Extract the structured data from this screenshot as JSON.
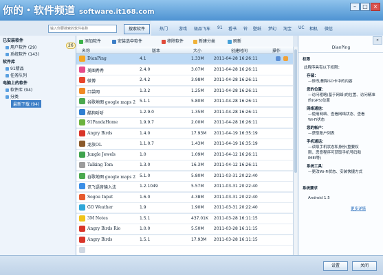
{
  "watermark": {
    "cn": "你的・软件频道",
    "url": "software.it168.com"
  },
  "search": {
    "placeholder": "输入你要搜索的软件名称",
    "button": "搜索软件"
  },
  "nav": [
    "热门",
    "游戏",
    "极品飞车",
    "91",
    "看书",
    "铃",
    "壁纸",
    "梦幻",
    "淘宝",
    "UC",
    "相机",
    "微信"
  ],
  "sidebar": {
    "installed_title": "已安装软件",
    "user_software": "用户软件 (29)",
    "system_software": "系统软件 (143)",
    "library_title": "软件库",
    "boutique": "91精品",
    "task_queue": "任务队列",
    "pc_title": "电脑上的软件",
    "pc_library": "软件库 (94)",
    "category": "分类",
    "recent_download": "最新下载 (94)",
    "badge": "26"
  },
  "toolbar": {
    "add": "添加软件",
    "install": "安装选中软件",
    "remove": "移除软件",
    "new_category": "新建分类",
    "refresh": "刷新"
  },
  "columns": {
    "name": "名称",
    "version": "版本",
    "size": "大小",
    "date": "创建时间",
    "action": "操作"
  },
  "rows": [
    {
      "name": "DianPing",
      "version": "4.1",
      "size": "1.33M",
      "date": "2011-04-28 16:26:11",
      "color": "#f5a623"
    },
    {
      "name": "美图秀秀",
      "version": "2.4.0",
      "size": "3.07M",
      "date": "2011-04-28 16:26:11",
      "color": "#e64b8a"
    },
    {
      "name": "微博",
      "version": "2.4.2",
      "size": "3.98M",
      "date": "2011-04-28 16:26:11",
      "color": "#e8452c"
    },
    {
      "name": "口袋网",
      "version": "1.3.2",
      "size": "1.25M",
      "date": "2011-04-28 16:26:11",
      "color": "#f08a24"
    },
    {
      "name": "谷歌地图 google maps 2",
      "version": "5.1.1",
      "size": "5.80M",
      "date": "2011-04-28 16:26:11",
      "color": "#4aa84f"
    },
    {
      "name": "酷狗听听",
      "version": "1.2.9.0",
      "size": "1.35M",
      "date": "2011-04-28 16:26:11",
      "color": "#2f7fd1"
    },
    {
      "name": "91PandaHome",
      "version": "1.9.9.7",
      "size": "2.00M",
      "date": "2011-04-28 16:26:11",
      "color": "#6cb33f"
    },
    {
      "name": "Angry Birds",
      "version": "1.4.0",
      "size": "17.93M",
      "date": "2011-04-19 16:35:19",
      "color": "#d9352a"
    },
    {
      "name": "龙族OL",
      "version": "1.1.0.7",
      "size": "1.43M",
      "date": "2011-04-19 16:35:19",
      "color": "#8a5a2b"
    },
    {
      "name": "Jungle Jewels",
      "version": "1.0",
      "size": "1.09M",
      "date": "2011-04-12 16:26:11",
      "color": "#3fa34d"
    },
    {
      "name": "Talking Tom",
      "version": "1.3.0",
      "size": "16.3M",
      "date": "2011-04-12 16:26:11",
      "color": "#9c9c9c"
    },
    {
      "name": "谷歌地图 google maps 2",
      "version": "5.1.0",
      "size": "5.80M",
      "date": "2011-03-31 20:22:40",
      "color": "#4aa84f"
    },
    {
      "name": "讯飞语音输入法",
      "version": "1.2.1049",
      "size": "5.57M",
      "date": "2011-03-31 20:22:40",
      "color": "#3a8ee6"
    },
    {
      "name": "Sogou Input",
      "version": "1.6.0",
      "size": "4.38M",
      "date": "2011-03-31 20:22:40",
      "color": "#e65a2e"
    },
    {
      "name": "GO Weather",
      "version": "1.9",
      "size": "1.90M",
      "date": "2011-03-31 20:22:40",
      "color": "#2fa7d9"
    },
    {
      "name": "3M Notes",
      "version": "1.5.1",
      "size": "437.01K",
      "date": "2011-03-28 16:11:15",
      "color": "#f0c419"
    },
    {
      "name": "Angry Birds Rio",
      "version": "1.0.0",
      "size": "5.50M",
      "date": "2011-03-28 16:11:15",
      "color": "#d9352a"
    },
    {
      "name": "Angry Birds",
      "version": "1.5.1",
      "size": "17.93M",
      "date": "2011-03-28 16:11:15",
      "color": "#d9352a"
    },
    {
      "name": "",
      "version": "",
      "size": "",
      "date": "",
      "color": "#cfd8e3"
    }
  ],
  "detail": {
    "title": "DianPing",
    "perm_header": "权限",
    "intro": "此程序具有以下权限：",
    "storage_t": "存储：",
    "storage_d": "—修改/删除SD卡中的内容",
    "loc_t": "您的位置：",
    "loc_d1": "—访问粗略(基于网络)的位置、访问精准",
    "loc_d2": "的(GPS)位置",
    "net_t": "网络通信：",
    "net_d1": "—使用网络、查看网络状态、查看",
    "net_d2": "Wi-Fi状态",
    "acct_t": "您的帐户：",
    "acct_d": "—获取账户列表",
    "phone_t": "手机通话：",
    "phone_d1": "—读取手机状态和身份(重要权",
    "phone_d2": "限，恶意程序可获取手机号码和",
    "phone_d3": "IMEI等)",
    "tool_t": "系统工具：",
    "tool_d": "—更改Wi-Fi状态、安装快捷方式",
    "req_header": "系统要求",
    "android": "Android 1.5",
    "more": "更多详情"
  },
  "bottom": {
    "settings": "设置",
    "close": "关闭"
  }
}
